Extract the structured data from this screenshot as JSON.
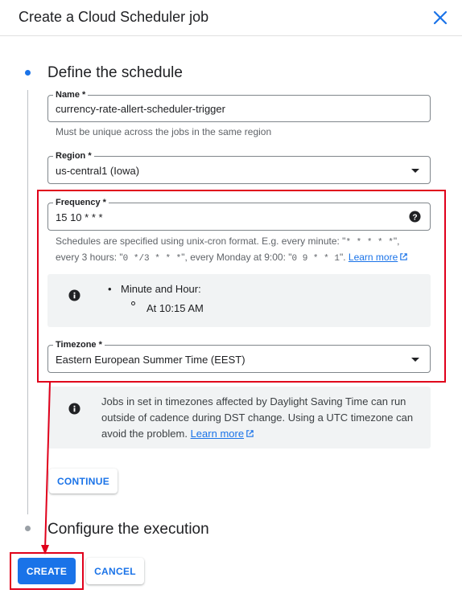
{
  "dialog": {
    "title": "Create a Cloud Scheduler job",
    "close_icon": "close-icon"
  },
  "step1": {
    "title": "Define the schedule",
    "name": {
      "label": "Name *",
      "value": "currency-rate-allert-scheduler-trigger",
      "hint": "Must be unique across the jobs in the same region"
    },
    "region": {
      "label": "Region *",
      "value": "us-central1 (Iowa)"
    },
    "frequency": {
      "label": "Frequency *",
      "value": "15 10 * * *",
      "hint_line1_pre": "Schedules are specified using unix-cron format. E.g. every minute: \"",
      "hint_code1": "* * * * *",
      "hint_line1_post": "\",",
      "hint_line2_pre": "every 3 hours: \"",
      "hint_code2": "0 */3 * * *",
      "hint_line2_mid": "\", every Monday at 9:00: \"",
      "hint_code3": "0 9 * * 1",
      "hint_line2_post": "\". ",
      "learn_more": "Learn more"
    },
    "summary": {
      "item": "Minute and Hour:",
      "subitem": "At 10:15 AM"
    },
    "timezone": {
      "label": "Timezone *",
      "value": "Eastern European Summer Time (EEST)"
    },
    "dst_info": {
      "line1": "Jobs in set in timezones affected by Daylight Saving Time can run",
      "line2": "outside of cadence during DST change. Using a UTC timezone can",
      "line3": "avoid the problem. ",
      "learn_more": "Learn more"
    },
    "continue_label": "CONTINUE"
  },
  "step2": {
    "title": "Configure the execution"
  },
  "actions": {
    "create_label": "CREATE",
    "cancel_label": "CANCEL"
  },
  "colors": {
    "accent": "#1a73e8",
    "annotation_red": "#e0001b",
    "info_bg": "#f1f3f4"
  }
}
